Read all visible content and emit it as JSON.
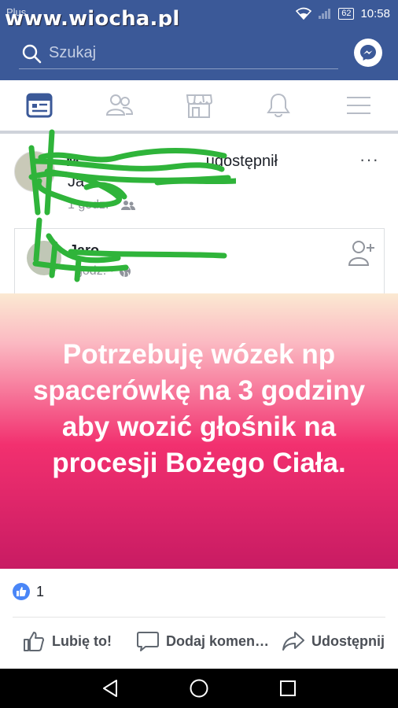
{
  "status_bar": {
    "carrier": "Plus",
    "watermark": "www.wiocha.pl",
    "battery": "62",
    "time": "10:58"
  },
  "search": {
    "placeholder": "Szukaj"
  },
  "tabs": [
    {
      "name": "news-feed",
      "icon": "news-feed-icon",
      "active": true
    },
    {
      "name": "friends",
      "icon": "friends-icon",
      "active": false
    },
    {
      "name": "marketplace",
      "icon": "marketplace-icon",
      "active": false
    },
    {
      "name": "notifications",
      "icon": "bell-icon",
      "active": false
    },
    {
      "name": "menu",
      "icon": "hamburger-icon",
      "active": false
    }
  ],
  "post": {
    "author_visible": "M",
    "shared_label": "udostępnił",
    "author_second_line": "Ja",
    "time": "1 godz. ·",
    "more": "···",
    "shared": {
      "name_visible": "Jaro",
      "time": "godz. ·"
    },
    "status_text": "Potrzebuję wózek np spacerówkę na 3 godziny aby wozić głośnik na procesji Bożego Ciała."
  },
  "reactions": {
    "count": "1"
  },
  "actions": {
    "like": "Lubię to!",
    "comment": "Dodaj komen…",
    "share": "Udostępnij"
  },
  "colors": {
    "facebook_blue": "#3b5998",
    "scribble_green": "#2fb43a",
    "status_gradient_top": "#fbe9d2",
    "status_gradient_bottom": "#c81b63"
  }
}
